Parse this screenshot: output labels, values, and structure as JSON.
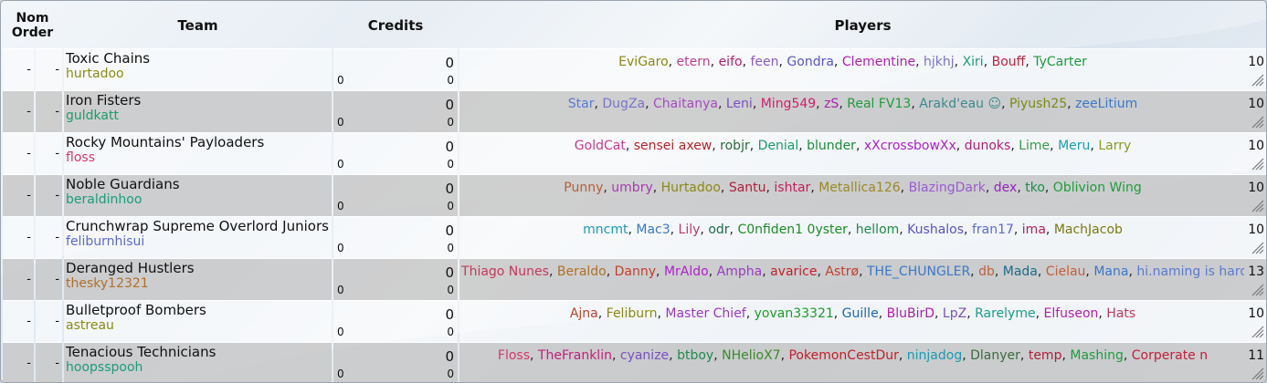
{
  "header": {
    "nom": "Nom",
    "order": "Order",
    "team": "Team",
    "credits": "Credits",
    "players": "Players"
  },
  "sep": ", ",
  "teams": [
    {
      "nom": "-",
      "order": "-",
      "name": "Toxic Chains",
      "captain": "hurtadoo",
      "captain_color": "#8c8c18",
      "credits": "0",
      "credits_a": "0",
      "credits_b": "0",
      "count": "10",
      "players": [
        {
          "n": "EviGaro",
          "c": "#8a8a12"
        },
        {
          "n": "etern",
          "c": "#c23f8e"
        },
        {
          "n": "eifo",
          "c": "#b0206e"
        },
        {
          "n": "feen",
          "c": "#8a5cc8"
        },
        {
          "n": "Gondra",
          "c": "#5d52d0"
        },
        {
          "n": "Clementine",
          "c": "#b01fb0"
        },
        {
          "n": "hjkhj",
          "c": "#7a74c8"
        },
        {
          "n": "Xiri",
          "c": "#1aa07a"
        },
        {
          "n": "Bouff",
          "c": "#c01f3c"
        },
        {
          "n": "TyCarter",
          "c": "#1e9c3c"
        }
      ]
    },
    {
      "nom": "-",
      "order": "-",
      "name": "Iron Fisters",
      "captain": "guldkatt",
      "captain_color": "#1a9c6a",
      "credits": "0",
      "credits_a": "0",
      "credits_b": "0",
      "count": "10",
      "players": [
        {
          "n": "Star",
          "c": "#5a7ad0"
        },
        {
          "n": "DugZa",
          "c": "#7a74c8"
        },
        {
          "n": "Chaitanya",
          "c": "#a84ac0"
        },
        {
          "n": "Leni",
          "c": "#7a50c0"
        },
        {
          "n": "Ming549",
          "c": "#d0206a"
        },
        {
          "n": "zS",
          "c": "#b01fb0"
        },
        {
          "n": "Real FV13",
          "c": "#1e9c3c"
        },
        {
          "n": "Arakd'eau ☺",
          "c": "#3a8a8a"
        },
        {
          "n": "Piyush25",
          "c": "#7a8a12"
        },
        {
          "n": "zeeLitium",
          "c": "#3a78c8"
        }
      ]
    },
    {
      "nom": "-",
      "order": "-",
      "name": "Rocky Mountains' Payloaders",
      "captain": "floss",
      "captain_color": "#d03a6a",
      "credits": "0",
      "credits_a": "0",
      "credits_b": "0",
      "count": "10",
      "players": [
        {
          "n": "GoldCat",
          "c": "#c83a90"
        },
        {
          "n": "sensei axew",
          "c": "#c01f2a"
        },
        {
          "n": "robjr",
          "c": "#2a6a3a"
        },
        {
          "n": "Denial",
          "c": "#1a9c6a"
        },
        {
          "n": "blunder",
          "c": "#1e8c3c"
        },
        {
          "n": "xXcrossbowXx",
          "c": "#b01fd0"
        },
        {
          "n": "dunoks",
          "c": "#b01f7a"
        },
        {
          "n": "Lime",
          "c": "#3a9a4a"
        },
        {
          "n": "Meru",
          "c": "#1aa0b0"
        },
        {
          "n": "Larry",
          "c": "#8a9a22"
        }
      ]
    },
    {
      "nom": "-",
      "order": "-",
      "name": "Noble Guardians",
      "captain": "beraldinhoo",
      "captain_color": "#1a9c7a",
      "credits": "0",
      "credits_a": "0",
      "credits_b": "0",
      "count": "10",
      "players": [
        {
          "n": "Punny",
          "c": "#b0603a"
        },
        {
          "n": "umbry",
          "c": "#a83ab0"
        },
        {
          "n": "Hurtadoo",
          "c": "#8a8a12"
        },
        {
          "n": "Santu",
          "c": "#b01f3a"
        },
        {
          "n": "ishtar",
          "c": "#c01f5a"
        },
        {
          "n": "Metallica126",
          "c": "#9a8a22"
        },
        {
          "n": "BlazingDark",
          "c": "#9a5ad0"
        },
        {
          "n": "dex",
          "c": "#9a20c0"
        },
        {
          "n": "tko",
          "c": "#1e8c4a"
        },
        {
          "n": "Oblivion Wing",
          "c": "#1e9c3c"
        }
      ]
    },
    {
      "nom": "-",
      "order": "-",
      "name": "Crunchwrap Supreme Overlord Juniors",
      "captain": "feliburnhisui",
      "captain_color": "#5a6ad0",
      "credits": "0",
      "credits_a": "0",
      "credits_b": "0",
      "count": "10",
      "players": [
        {
          "n": "mncmt",
          "c": "#1a9ab0"
        },
        {
          "n": "Mac3",
          "c": "#3a78c8"
        },
        {
          "n": "Lily",
          "c": "#c03a6a"
        },
        {
          "n": "odr",
          "c": "#1e6c4a"
        },
        {
          "n": "C0nfiden1 0yster",
          "c": "#1e8c2a"
        },
        {
          "n": "hellom",
          "c": "#1e8c4a"
        },
        {
          "n": "Kushalos",
          "c": "#5a52c0"
        },
        {
          "n": "fran17",
          "c": "#5a6ad0"
        },
        {
          "n": "ima",
          "c": "#b01f5a"
        },
        {
          "n": "MachJacob",
          "c": "#7a7a12"
        }
      ]
    },
    {
      "nom": "-",
      "order": "-",
      "name": "Deranged Hustlers",
      "captain": "thesky12321",
      "captain_color": "#b0702a",
      "credits": "0",
      "credits_a": "0",
      "credits_b": "0",
      "count": "13",
      "players": [
        {
          "n": "Thiago Nunes",
          "c": "#c03a5a"
        },
        {
          "n": "Beraldo",
          "c": "#b0702a"
        },
        {
          "n": "Danny",
          "c": "#c0402a"
        },
        {
          "n": "MrAldo",
          "c": "#b01fd0"
        },
        {
          "n": "Ampha",
          "c": "#9a3ac0"
        },
        {
          "n": "avarice",
          "c": "#c01f2a"
        },
        {
          "n": "Astrø",
          "c": "#c0402a"
        },
        {
          "n": "THE_CHUNGLER",
          "c": "#3a78c8"
        },
        {
          "n": "db",
          "c": "#c0603a"
        },
        {
          "n": "Mada",
          "c": "#1a6a8a"
        },
        {
          "n": "Cielau",
          "c": "#c0603a"
        },
        {
          "n": "Mana",
          "c": "#3a78c8"
        },
        {
          "n": "hi.naming is hard",
          "c": "#5a7ad0"
        }
      ]
    },
    {
      "nom": "-",
      "order": "-",
      "name": "Bulletproof Bombers",
      "captain": "astreau",
      "captain_color": "#8a8a12",
      "credits": "0",
      "credits_a": "0",
      "credits_b": "0",
      "count": "10",
      "players": [
        {
          "n": "Ajna",
          "c": "#c0402a"
        },
        {
          "n": "Feliburn",
          "c": "#8a8a12"
        },
        {
          "n": "Master Chief",
          "c": "#9a3ac0"
        },
        {
          "n": "yovan33321",
          "c": "#1e9c2a"
        },
        {
          "n": "Guille",
          "c": "#1a6ab0"
        },
        {
          "n": "BluBirD",
          "c": "#b01fb0"
        },
        {
          "n": "LpZ",
          "c": "#7a50c0"
        },
        {
          "n": "Rarelyme",
          "c": "#1a9c8a"
        },
        {
          "n": "Elfuseon",
          "c": "#b01fb0"
        },
        {
          "n": "Hats",
          "c": "#c03a5a"
        }
      ]
    },
    {
      "nom": "-",
      "order": "-",
      "name": "Tenacious Technicians",
      "captain": "hoopsspooh",
      "captain_color": "#1a9c7a",
      "credits": "0",
      "credits_a": "0",
      "credits_b": "0",
      "count": "11",
      "players": [
        {
          "n": "Floss",
          "c": "#d03a6a"
        },
        {
          "n": "TheFranklin",
          "c": "#c01f7a"
        },
        {
          "n": "cyanize",
          "c": "#7a50c0"
        },
        {
          "n": "btboy",
          "c": "#1e8c4a"
        },
        {
          "n": "NHelioX7",
          "c": "#3a8a2a"
        },
        {
          "n": "PokemonCestDur",
          "c": "#c01f2a"
        },
        {
          "n": "ninjadog",
          "c": "#1a9ab0"
        },
        {
          "n": "Dlanyer",
          "c": "#3a6a3a"
        },
        {
          "n": "temp",
          "c": "#b01f3a"
        },
        {
          "n": "Mashing",
          "c": "#1e9c3c"
        },
        {
          "n": "Corperate n",
          "c": "#c01f3a"
        }
      ]
    }
  ]
}
